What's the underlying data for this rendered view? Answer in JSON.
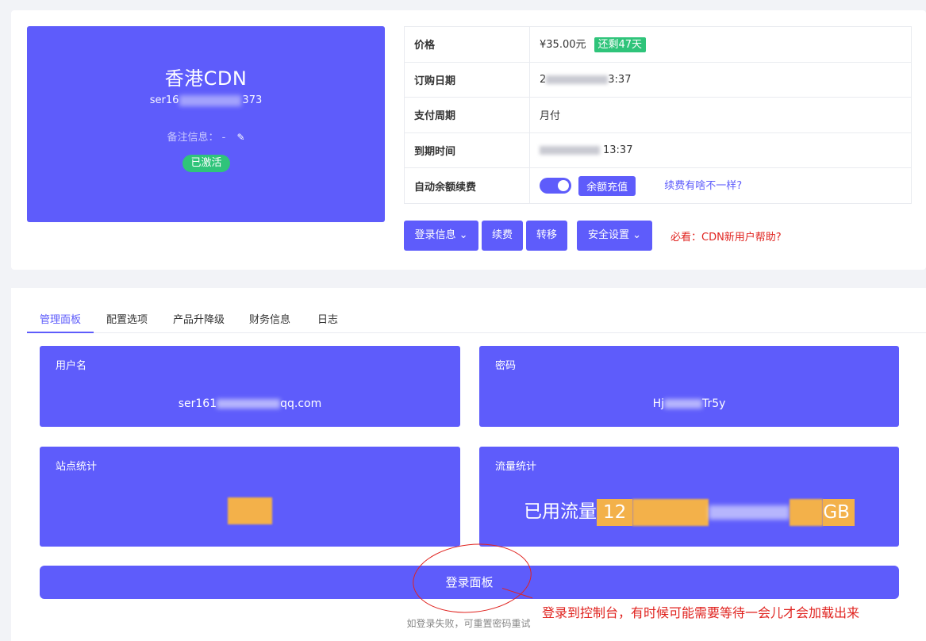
{
  "product": {
    "name": "香港CDN",
    "id_prefix": "ser16",
    "id_suffix": "373",
    "remark_label": "备注信息：",
    "remark_value": "-",
    "status": "已激活"
  },
  "info_table": {
    "price_label": "价格",
    "price_value": "¥35.00元",
    "remaining": "还剩47天",
    "order_date_label": "订购日期",
    "order_date_prefix": "2",
    "order_date_suffix": "3:37",
    "cycle_label": "支付周期",
    "cycle_value": "月付",
    "expire_label": "到期时间",
    "expire_suffix": "13:37",
    "auto_renew_label": "自动余额续费",
    "auto_renew_on": true,
    "recharge_label": "余额充值",
    "renew_diff_link": "续费有啥不一样?"
  },
  "actions": {
    "login_info": "登录信息",
    "renew": "续费",
    "transfer": "转移",
    "security": "安全设置",
    "help": "必看：CDN新用户帮助?"
  },
  "tabs": [
    "管理面板",
    "配置选项",
    "产品升降级",
    "财务信息",
    "日志"
  ],
  "panels": {
    "username_label": "用户名",
    "username_prefix": "ser161",
    "username_suffix": "qq.com",
    "password_label": "密码",
    "password_prefix": "Hj",
    "password_suffix": "Tr5y",
    "sites_label": "站点统计",
    "traffic_label": "流量统计",
    "traffic_prefix": "已用流量",
    "traffic_num_prefix": "12",
    "traffic_unit": "GB"
  },
  "login_panel_button": "登录面板",
  "login_hint": "如登录失败，可重置密码重试",
  "annotation": "登录到控制台，有时候可能需要等待一会儿才会加载出来",
  "colors": {
    "accent": "#5e5cfb",
    "success": "#2fc47a",
    "danger": "#e0231f"
  }
}
